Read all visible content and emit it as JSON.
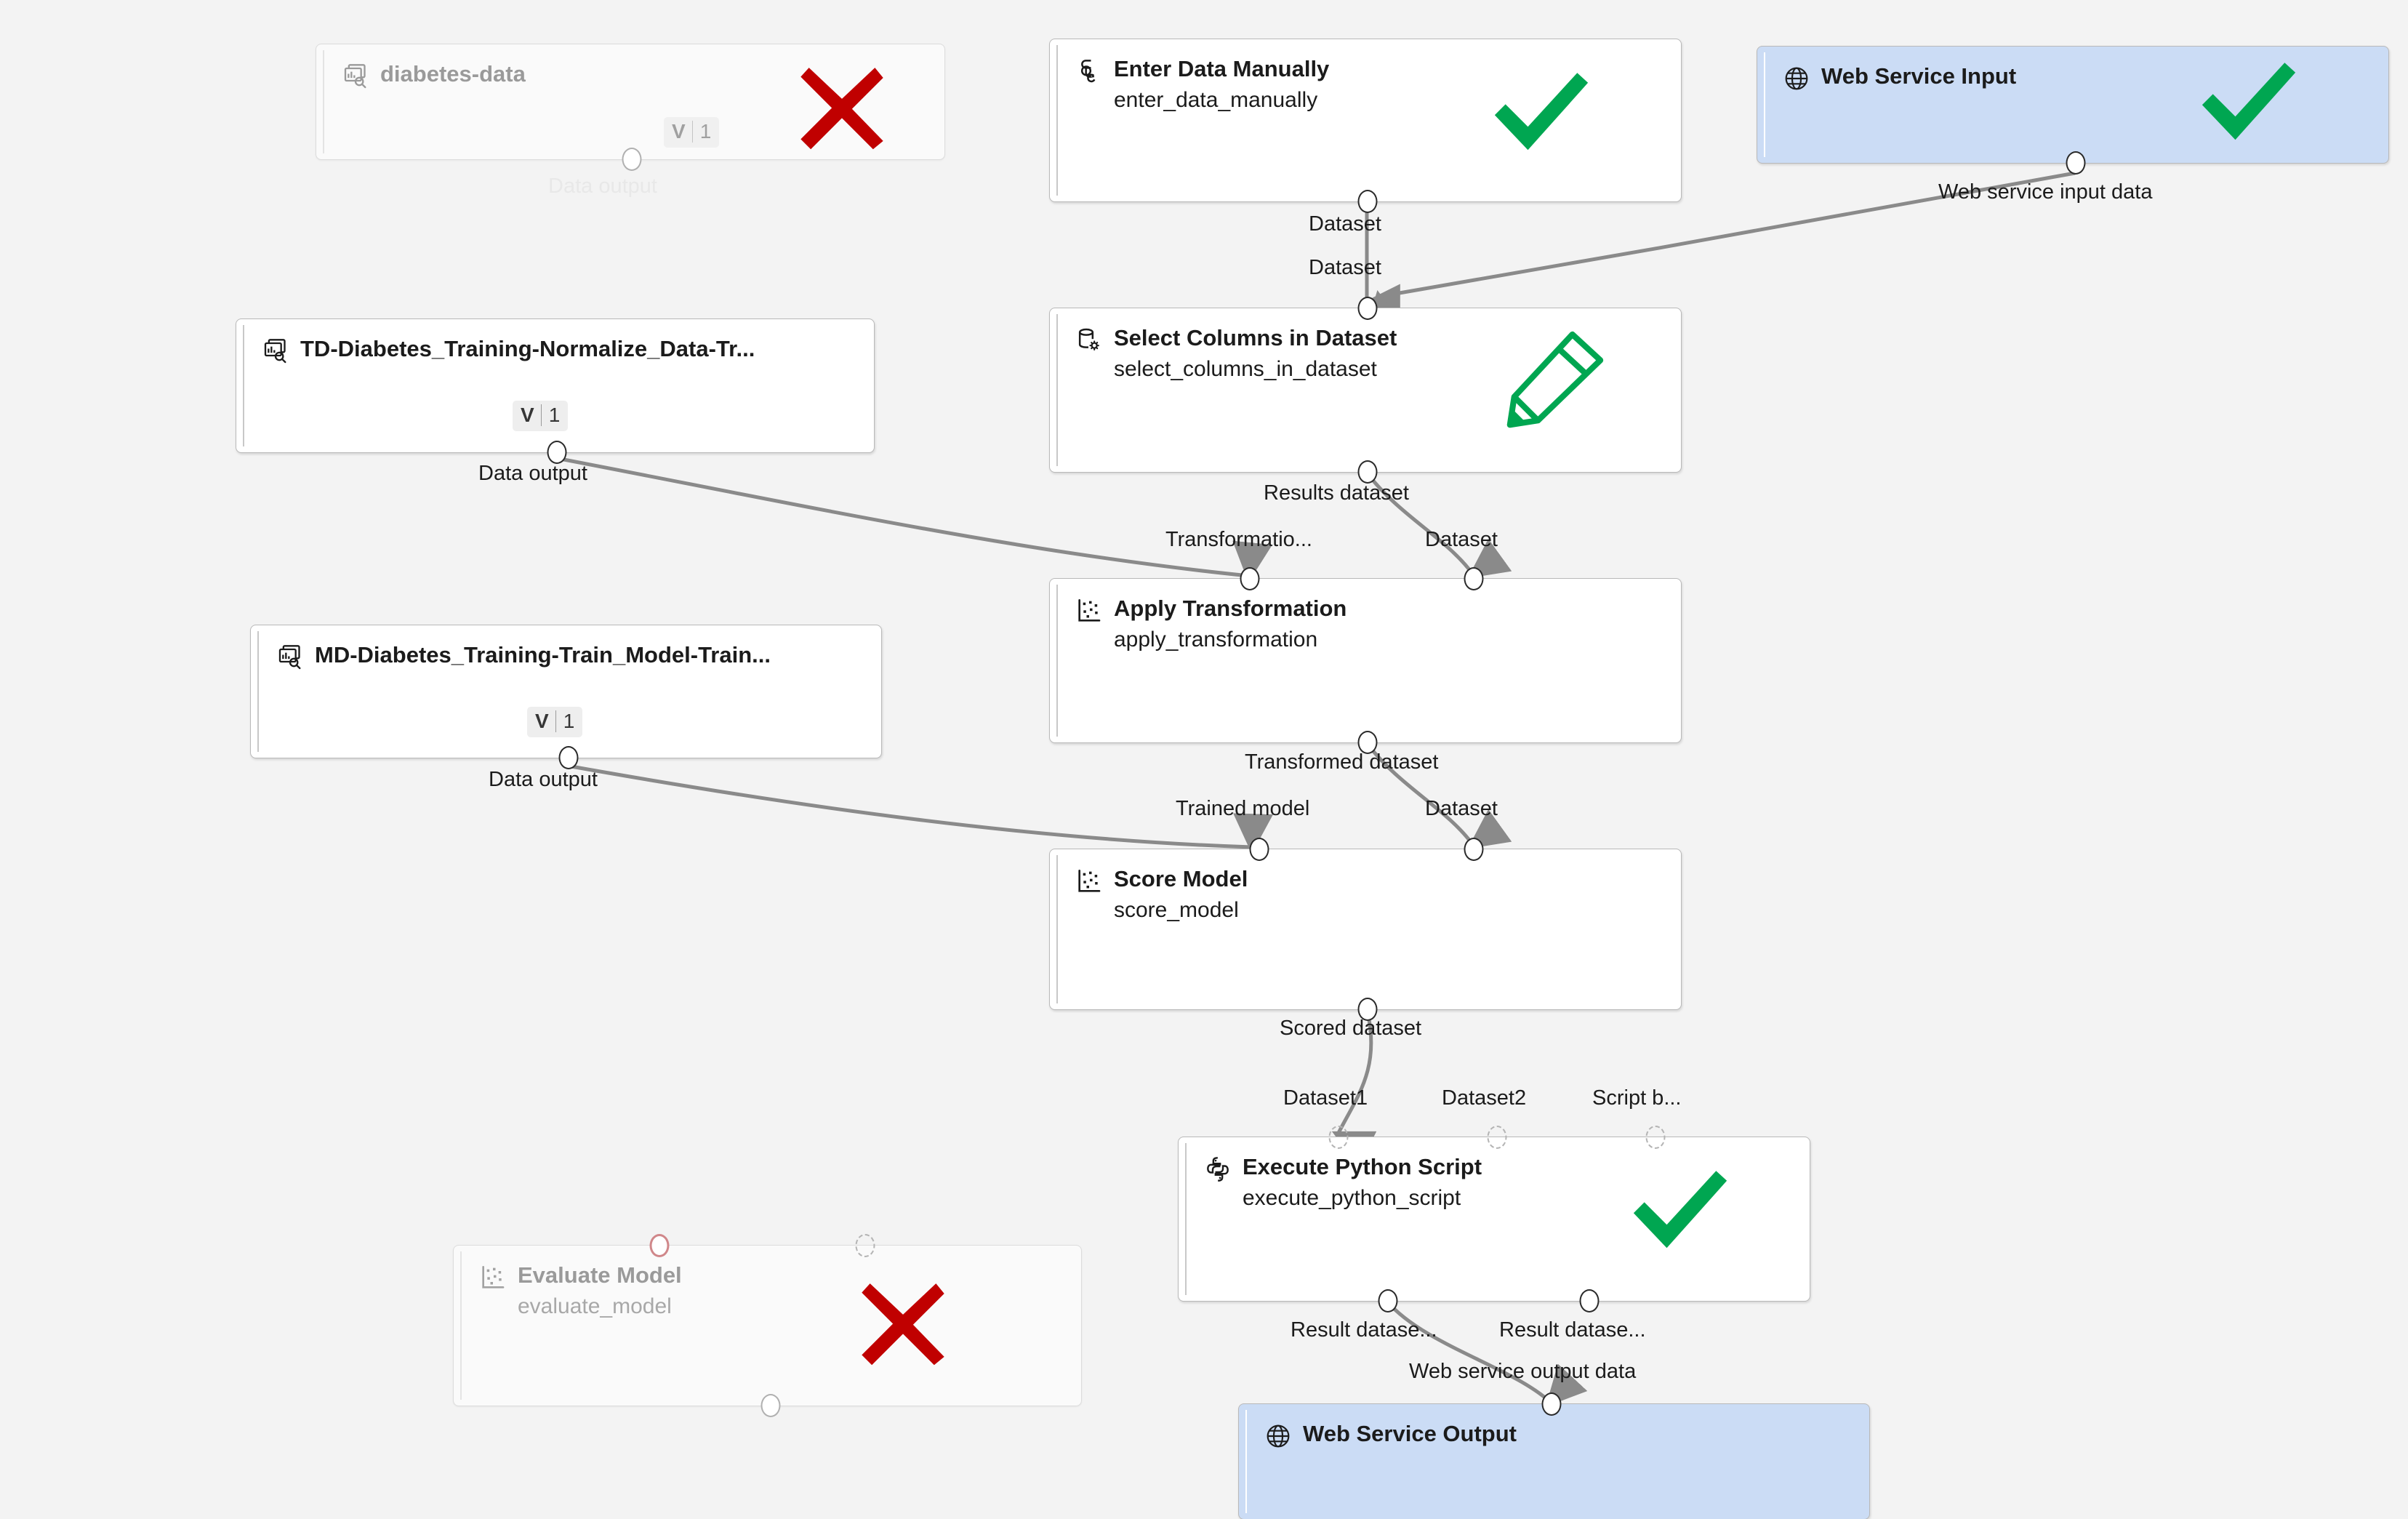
{
  "canvas": {
    "background": "#f3f3f3",
    "accent_blue": "#cbdcf5",
    "check_green": "#00a651",
    "error_red": "#c00000",
    "pencil_green": "#00a651"
  },
  "nodes": [
    {
      "id": "diabetes-data",
      "title": "diabetes-data",
      "subtitle": "",
      "icon": "dataset-icon",
      "state": "faded",
      "status": "error",
      "version": {
        "label": "V",
        "value": "1"
      },
      "kind": "dataset"
    },
    {
      "id": "enter-data-manually",
      "title": "Enter Data Manually",
      "subtitle": "enter_data_manually",
      "icon": "enter-data-icon",
      "state": "normal",
      "status": "success",
      "kind": "module"
    },
    {
      "id": "web-service-input",
      "title": "Web Service Input",
      "subtitle": "",
      "icon": "globe-icon",
      "state": "normal",
      "status": "success",
      "kind": "webservice"
    },
    {
      "id": "td-diabetes-training-normalize",
      "title": "TD-Diabetes_Training-Normalize_Data-Tr...",
      "subtitle": "",
      "icon": "dataset-icon",
      "state": "normal",
      "status": "none",
      "version": {
        "label": "V",
        "value": "1"
      },
      "kind": "dataset"
    },
    {
      "id": "select-columns-in-dataset",
      "title": "Select Columns in Dataset",
      "subtitle": "select_columns_in_dataset",
      "icon": "database-gear-icon",
      "state": "normal",
      "status": "edited",
      "kind": "module"
    },
    {
      "id": "md-diabetes-training-train-model",
      "title": "MD-Diabetes_Training-Train_Model-Train...",
      "subtitle": "",
      "icon": "dataset-icon",
      "state": "normal",
      "status": "none",
      "version": {
        "label": "V",
        "value": "1"
      },
      "kind": "dataset"
    },
    {
      "id": "apply-transformation",
      "title": "Apply Transformation",
      "subtitle": "apply_transformation",
      "icon": "scatter-icon",
      "state": "normal",
      "status": "none",
      "kind": "module"
    },
    {
      "id": "score-model",
      "title": "Score Model",
      "subtitle": "score_model",
      "icon": "scatter-icon",
      "state": "normal",
      "status": "none",
      "kind": "module"
    },
    {
      "id": "execute-python-script",
      "title": "Execute Python Script",
      "subtitle": "execute_python_script",
      "icon": "python-icon",
      "state": "normal",
      "status": "success",
      "kind": "module"
    },
    {
      "id": "evaluate-model",
      "title": "Evaluate Model",
      "subtitle": "evaluate_model",
      "icon": "scatter-icon",
      "state": "faded",
      "status": "error",
      "kind": "module"
    },
    {
      "id": "web-service-output",
      "title": "Web Service Output",
      "subtitle": "",
      "icon": "globe-icon",
      "state": "normal",
      "status": "none",
      "kind": "webservice"
    }
  ],
  "port_labels": {
    "diabetes_data_output": "Data output",
    "enter_data_manually_out": "Dataset",
    "web_service_input_out": "Web service input data",
    "select_columns_in": "Dataset",
    "select_columns_out": "Results dataset",
    "td_normalize_out": "Data output",
    "apply_transformation_in_1": "Transformatio...",
    "apply_transformation_in_2": "Dataset",
    "apply_transformation_out": "Transformed dataset",
    "md_train_model_out": "Data output",
    "score_model_in_1": "Trained model",
    "score_model_in_2": "Dataset",
    "score_model_out": "Scored dataset",
    "python_in_1": "Dataset1",
    "python_in_2": "Dataset2",
    "python_in_3": "Script b...",
    "python_out_1": "Result datase...",
    "python_out_2": "Result datase...",
    "web_service_output_in": "Web service output data"
  }
}
